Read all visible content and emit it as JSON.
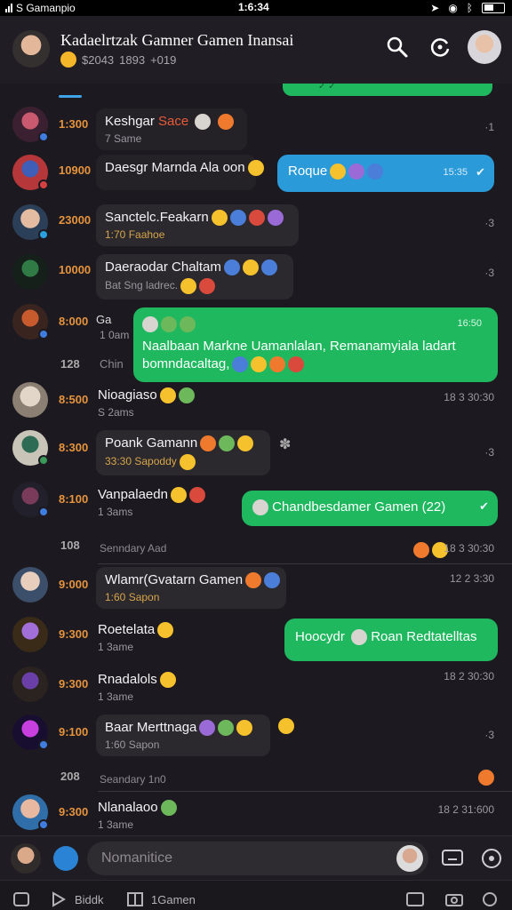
{
  "status_bar": {
    "carrier": "S Gamanpio",
    "time": "1:6:34"
  },
  "header": {
    "title": "Kadaelrtzak Gamner Gamen Inansai",
    "subtitle_a": "$2043",
    "subtitle_b": "1893",
    "subtitle_c": "+019"
  },
  "messages": [
    {
      "time": "1:300",
      "name": "Keshgar",
      "name_extra": "Sace",
      "sub": "7 Same",
      "meta": "·1"
    },
    {
      "time": "10900",
      "name": "Daesgr Marnda Ala oon",
      "sub": "",
      "bubble": "Roque",
      "bubble_time": "15:35"
    },
    {
      "time": "23000",
      "name": "Sanctelc.Feakarn",
      "sub": "1:70 Faahoe",
      "meta": "·3"
    },
    {
      "time": "10000",
      "name": "Daeraodar Chaltam",
      "sub": "Bat Sng ladrec.",
      "meta": "·3"
    },
    {
      "time": "8:000",
      "name": "Ga",
      "sub": "1 0am",
      "bubble_head": "",
      "bubble_time": "16:50",
      "bubble": "Naalbaan Markne Uamanlalan, Remanamyiala ladart bomndacaltag,"
    },
    {
      "time": "8:500",
      "name": "Nioagiaso",
      "sub": "S 2ams",
      "meta": "18 3 30:30"
    },
    {
      "time": "8:300",
      "name": "Poank Gamann",
      "sub": "33:30 Sapoddy",
      "meta": "·3"
    },
    {
      "time": "8:100",
      "name": "Vanpalaedn",
      "sub": "1 3ams",
      "bubble": "Chandbesdamer Gamen (22)"
    },
    {
      "time": "9:000",
      "name": "Wlamr(Gvatarn Gamen",
      "sub": "1:60 Sapon",
      "meta": "12 2 3:30"
    },
    {
      "time": "9:300",
      "name": "Roetelata",
      "sub": "1 3ame",
      "bubble": "Hoocydr",
      "bubble_b": "Roan Redtatelltas"
    },
    {
      "time": "9:300",
      "name": "Rnadalols",
      "sub": "1 3ame",
      "meta": "18 2 30:30"
    },
    {
      "time": "9:100",
      "name": "Baar Merttnaga",
      "sub": "1:60 Sapon",
      "meta": "·3"
    },
    {
      "time": "9:300",
      "name": "Nlanalaoo",
      "sub": "1 3ame",
      "meta": "18 2 31:600"
    }
  ],
  "separators": [
    {
      "num": "128",
      "label": "Chin"
    },
    {
      "num": "108",
      "label": "Senndary Aad"
    },
    {
      "num": "208",
      "label": "Seandary 1n0"
    }
  ],
  "composer": {
    "placeholder": "Nomanitice"
  },
  "bottom_nav": {
    "item1": "Biddk",
    "item2": "1Gamen"
  }
}
